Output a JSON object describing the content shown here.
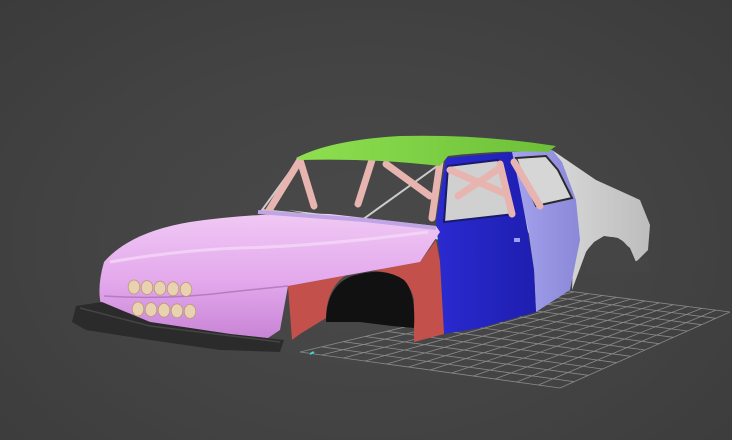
{
  "viewport": {
    "background_color": "#454545",
    "grid_color": "#8a8a8a",
    "grid_axis_color": "#3fd6c4"
  },
  "model": {
    "icon": "car-body-3d-model",
    "part_colors": {
      "hood_and_front_fender": "#d99be6",
      "roof": "#7ed045",
      "front_wheel_arch_panel": "#c4504c",
      "front_door": "#2626c4",
      "rear_door": "#9d9be6",
      "rear_quarter_panel": "#cfcfcf",
      "bumper": "#2b2b2b",
      "headlights": "#e8d2b0",
      "roll_cage": "#e8b4b0",
      "interior": "#d8d8d8"
    }
  }
}
